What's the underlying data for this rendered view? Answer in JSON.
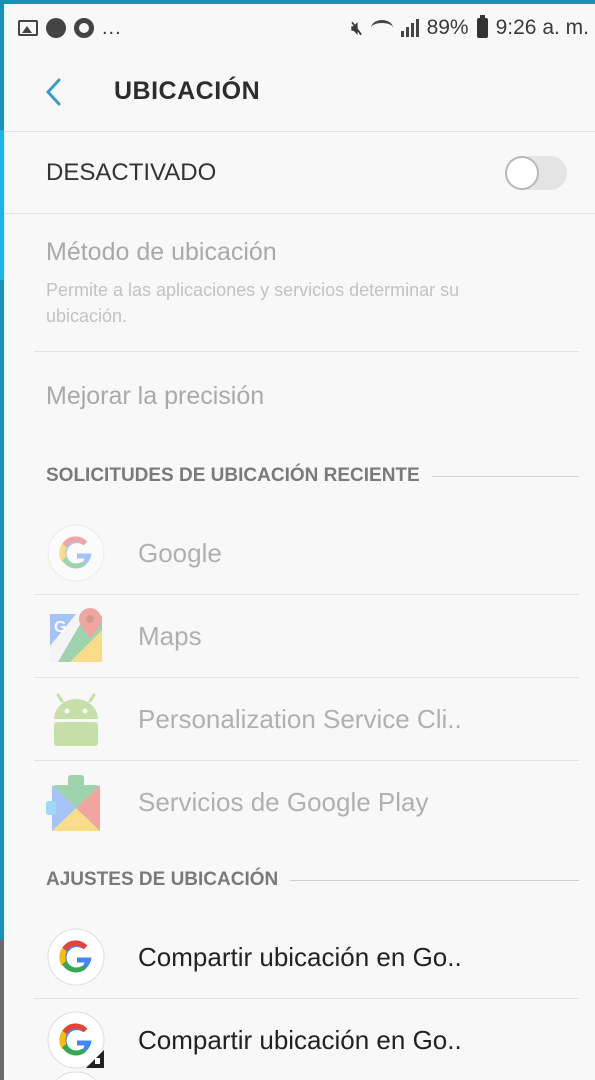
{
  "status_bar": {
    "left_icons": [
      "gallery-icon",
      "messenger-icon",
      "chrome-icon"
    ],
    "overflow": "...",
    "battery": "89%",
    "time": "9:26 a. m."
  },
  "toolbar": {
    "title": "UBICACIÓN",
    "back_icon": "chevron-left-icon"
  },
  "master_toggle": {
    "label": "DESACTIVADO",
    "on": false
  },
  "method": {
    "title": "Método de ubicación",
    "subtitle": "Permite a las aplicaciones y servicios determinar su ubicación."
  },
  "accuracy": {
    "label": "Mejorar la precisión"
  },
  "recent_requests": {
    "header": "SOLICITUDES DE UBICACIÓN RECIENTE",
    "items": [
      {
        "name": "Google",
        "icon": "google-icon"
      },
      {
        "name": "Maps",
        "icon": "maps-icon"
      },
      {
        "name": "Personalization Service Cli..",
        "icon": "android-icon"
      },
      {
        "name": "Servicios de Google Play",
        "icon": "play-services-icon"
      }
    ]
  },
  "location_settings": {
    "header": "AJUSTES DE UBICACIÓN",
    "items": [
      {
        "name": "Compartir ubicación en Go..",
        "icon": "google-icon"
      },
      {
        "name": "Compartir ubicación en Go..",
        "icon": "google-work-icon"
      }
    ]
  },
  "colors": {
    "google_blue": "#4285F4",
    "google_red": "#EA4335",
    "google_yellow": "#FBBC05",
    "google_green": "#34A853",
    "accent": "#3a9bc9"
  }
}
